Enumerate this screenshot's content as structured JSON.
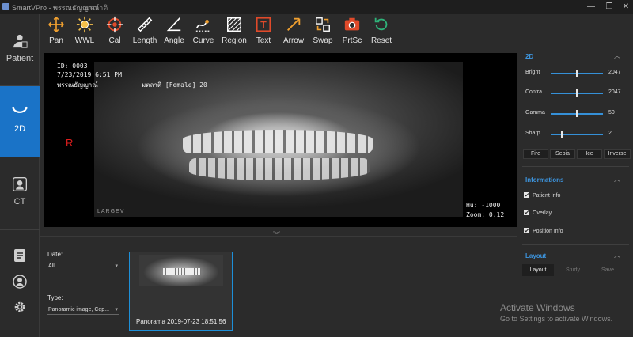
{
  "window": {
    "title": "SmartVPro - พรรณธัญญาณ์",
    "title2": "มตลาติ",
    "minimize": "—",
    "maximize": "❐",
    "close": "✕"
  },
  "toolbar": {
    "tools": [
      {
        "label": "Pan",
        "icon": "pan-icon",
        "color": "#f0a030"
      },
      {
        "label": "WWL",
        "icon": "brightness-icon",
        "color": "#f5c04a"
      },
      {
        "label": "Cal",
        "icon": "calibrate-icon",
        "color": "#e04a2a"
      },
      {
        "label": "Length",
        "icon": "ruler-icon",
        "color": "#ffffff"
      },
      {
        "label": "Angle",
        "icon": "angle-icon",
        "color": "#ffffff"
      },
      {
        "label": "Curve",
        "icon": "curve-icon",
        "color": "#ffffff"
      },
      {
        "label": "Region",
        "icon": "region-icon",
        "color": "#ffffff"
      },
      {
        "label": "Text",
        "icon": "text-icon",
        "color": "#e04a2a"
      },
      {
        "label": "Arrow",
        "icon": "arrow-icon",
        "color": "#f0a030"
      },
      {
        "label": "Swap",
        "icon": "swap-icon",
        "color": "#f0a030"
      },
      {
        "label": "PrtSc",
        "icon": "screenshot-icon",
        "color": "#e04a2a"
      },
      {
        "label": "Reset",
        "icon": "reset-icon",
        "color": "#2fb37a"
      }
    ]
  },
  "nav": {
    "patient": "Patient",
    "twod": "2D",
    "ct": "CT"
  },
  "viewer": {
    "overlay_id": "ID: 0003",
    "overlay_date": "7/23/2019 6:51 PM",
    "overlay_name": "พรรณธัญญาณ์",
    "overlay_gender": "มตลาติ [Female] 20",
    "orientation": "R",
    "hu": "Hu: -1000",
    "zoom": "Zoom: 0.12",
    "brand": "LARGEV",
    "collapse": "︾"
  },
  "study": {
    "date_label": "Date:",
    "date_value": "All",
    "type_label": "Type:",
    "type_value": "Panoramic image, Cep...",
    "thumb_caption": "Panorama   2019-07-23 18:51:56"
  },
  "panel": {
    "twod_title": "2D",
    "sliders": [
      {
        "name": "Bright",
        "value": "2047",
        "position": 0.5
      },
      {
        "name": "Contra",
        "value": "2047",
        "position": 0.5
      },
      {
        "name": "Gamma",
        "value": "50",
        "position": 0.5
      },
      {
        "name": "Sharp",
        "value": "2",
        "position": 0.2
      }
    ],
    "modes": [
      "Fire",
      "Sepia",
      "Ice",
      "Inverse"
    ],
    "info_title": "Informations",
    "checks": [
      "Patient Info",
      "Overlay",
      "Position Info"
    ],
    "layout_title": "Layout",
    "layout_buttons": [
      "Layout",
      "Study",
      "Save"
    ],
    "chevron": "︿"
  },
  "watermark": {
    "line1": "Activate Windows",
    "line2": "Go to Settings to activate Windows."
  }
}
